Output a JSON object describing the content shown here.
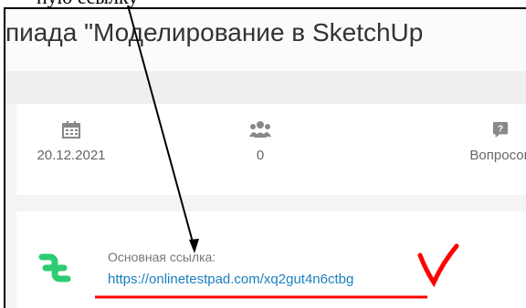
{
  "doc": {
    "fragment_text": "ную ссылку"
  },
  "page": {
    "title": "пиада \"Моделирование в SketchUp"
  },
  "stats": [
    {
      "icon": "calendar-icon",
      "value": "20.12.2021"
    },
    {
      "icon": "users-icon",
      "value": "0"
    },
    {
      "icon": "question-icon",
      "value": "Вопросов"
    }
  ],
  "link": {
    "label": "Основная ссылка:",
    "url": "https://onlinetestpad.com/xq2gut4n6ctbg",
    "annotation": "V"
  },
  "colors": {
    "accent_green": "#2ecc71",
    "link_blue": "#1a7fbf",
    "mark_red": "#ff0000",
    "icon_gray": "#888888"
  }
}
